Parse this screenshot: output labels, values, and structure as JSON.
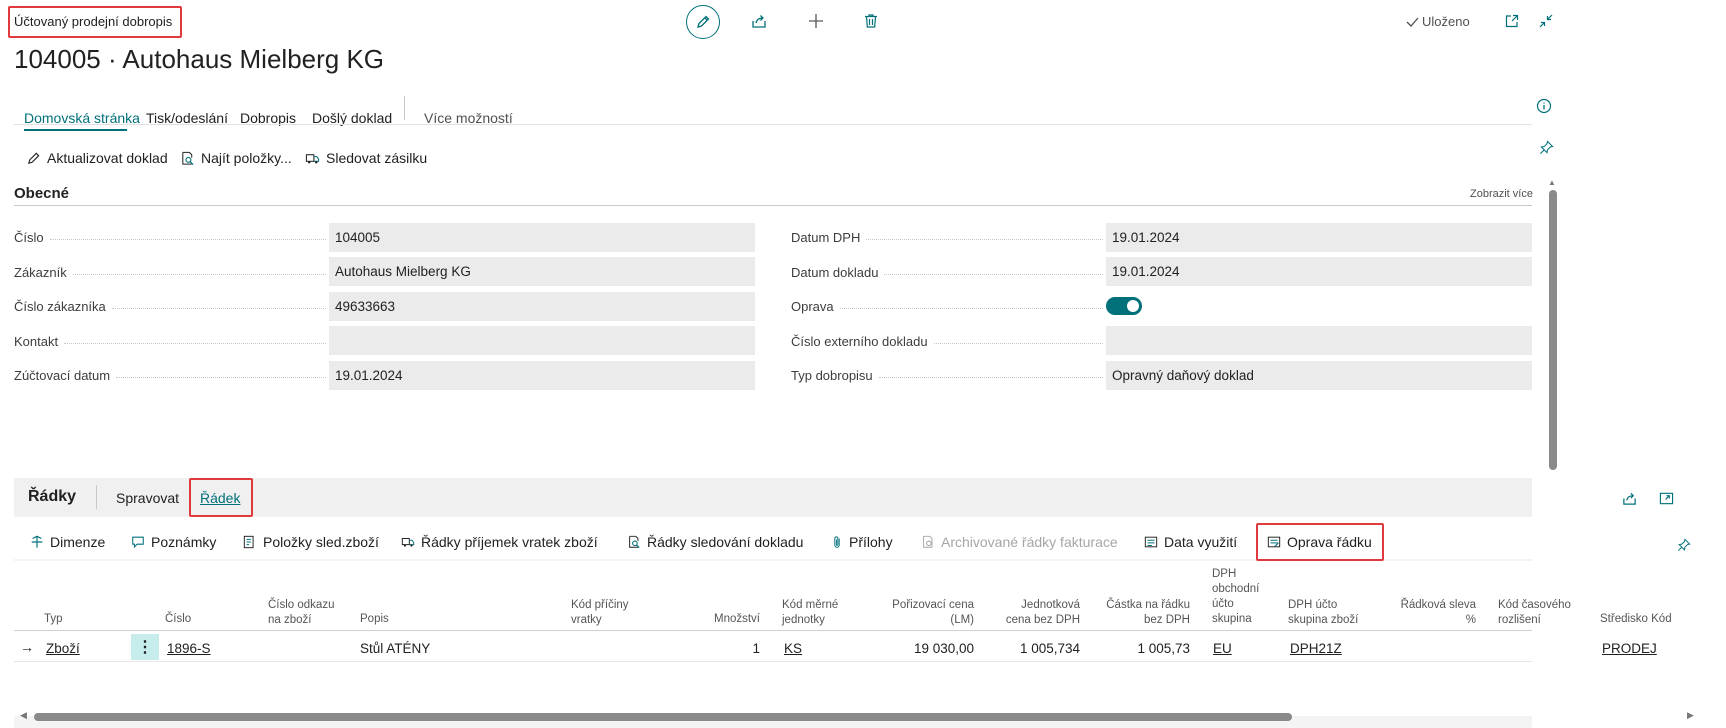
{
  "header": {
    "breadcrumb": "Účtovaný prodejní dobropis",
    "title": "104005 · Autohaus Mielberg KG",
    "saved_status": "Uloženo"
  },
  "tabs": [
    {
      "label": "Domovská stránka",
      "active": true
    },
    {
      "label": "Tisk/odeslání",
      "active": false
    },
    {
      "label": "Dobropis",
      "active": false
    },
    {
      "label": "Došlý doklad",
      "active": false
    },
    {
      "label": "Více možností",
      "active": false
    }
  ],
  "actions": [
    {
      "label": "Aktualizovat doklad",
      "icon": "pencil-icon"
    },
    {
      "label": "Najít položky...",
      "icon": "find-entries-icon"
    },
    {
      "label": "Sledovat zásilku",
      "icon": "track-shipment-icon"
    }
  ],
  "general": {
    "title": "Obecné",
    "show_more": "Zobrazit více",
    "left_fields": [
      {
        "label": "Číslo",
        "value": "104005"
      },
      {
        "label": "Zákazník",
        "value": "Autohaus Mielberg KG"
      },
      {
        "label": "Číslo zákazníka",
        "value": "49633663"
      },
      {
        "label": "Kontakt",
        "value": ""
      },
      {
        "label": "Zúčtovací datum",
        "value": "19.01.2024"
      }
    ],
    "right_fields": [
      {
        "label": "Datum DPH",
        "value": "19.01.2024"
      },
      {
        "label": "Datum dokladu",
        "value": "19.01.2024"
      },
      {
        "label": "Oprava",
        "value": "",
        "toggle_on": true
      },
      {
        "label": "Číslo externího dokladu",
        "value": ""
      },
      {
        "label": "Typ dobropisu",
        "value": "Opravný daňový doklad"
      }
    ]
  },
  "lines": {
    "title": "Řádky",
    "tabs": [
      {
        "label": "Spravovat",
        "active": false
      },
      {
        "label": "Řádek",
        "active": true
      }
    ],
    "actions": [
      {
        "label": "Dimenze",
        "icon": "dimensions-icon",
        "disabled": false
      },
      {
        "label": "Poznámky",
        "icon": "comments-icon",
        "disabled": false
      },
      {
        "label": "Položky sled.zboží",
        "icon": "item-tracking-icon",
        "disabled": false
      },
      {
        "label": "Řádky příjemek vratek zboží",
        "icon": "return-receipt-icon",
        "disabled": false
      },
      {
        "label": "Řádky sledování dokladu",
        "icon": "document-tracking-icon",
        "disabled": false
      },
      {
        "label": "Přílohy",
        "icon": "paperclip-icon",
        "disabled": false
      },
      {
        "label": "Archivované řádky fakturace",
        "icon": "archive-icon",
        "disabled": true
      },
      {
        "label": "Data využití",
        "icon": "usage-data-icon",
        "disabled": false
      },
      {
        "label": "Oprava řádku",
        "icon": "line-correction-icon",
        "disabled": false
      }
    ],
    "columns": [
      "Typ",
      "Číslo",
      "Číslo odkazu na zboží",
      "Popis",
      "Kód příčiny vratky",
      "Množství",
      "Kód měrné jednotky",
      "Pořizovací cena (LM)",
      "Jednotková cena bez DPH",
      "Částka na řádku bez DPH",
      "DPH obchodní účto skupina",
      "DPH účto skupina zboží",
      "Řádková sleva %",
      "Kód časového rozlišení",
      "Středisko Kód"
    ],
    "rows": [
      {
        "type": "Zboží",
        "number": "1896-S",
        "ref": "",
        "description": "Stůl ATÉNY",
        "return_reason": "",
        "quantity": "1",
        "uom": "KS",
        "unit_cost": "19 030,00",
        "unit_price": "1 005,734",
        "line_amount": "1 005,73",
        "vat_bus": "EU",
        "vat_prod": "DPH21Z",
        "discount": "",
        "deferral": "",
        "department": "PRODEJ"
      }
    ]
  },
  "colors": {
    "accent": "#00707a",
    "highlight": "#e0393e",
    "field_bg": "#ebebeb"
  }
}
